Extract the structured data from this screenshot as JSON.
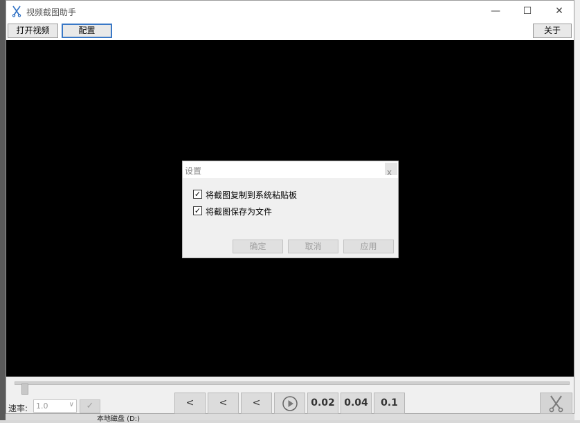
{
  "window": {
    "title": "视频截图助手",
    "app_icon": "scissors-icon",
    "controls": {
      "minimize": "—",
      "maximize": "☐",
      "close": "✕"
    }
  },
  "toolbar": {
    "open_video": "打开视频",
    "config": "配置",
    "about": "关于"
  },
  "dialog": {
    "title": "设置",
    "close_glyph": "x",
    "options": [
      {
        "label": "将截图复制到系统粘贴板",
        "checked": true
      },
      {
        "label": "将截图保存为文件",
        "checked": true
      }
    ],
    "buttons": {
      "ok": "确定",
      "cancel": "取消",
      "apply": "应用"
    }
  },
  "player": {
    "position_fraction": 0.0,
    "speed_label": "速率:",
    "speed_value": "1.0",
    "speed_confirm_icon": "check-icon",
    "buttons": {
      "back1": "<",
      "back2": "<",
      "back3": "<",
      "play_icon": "play-icon",
      "step_002": "0.02",
      "step_004": "0.04",
      "step_01": "0.1",
      "cut_icon": "scissors-icon"
    }
  },
  "background": {
    "partial_text": "本地磁盘 (D:)"
  }
}
